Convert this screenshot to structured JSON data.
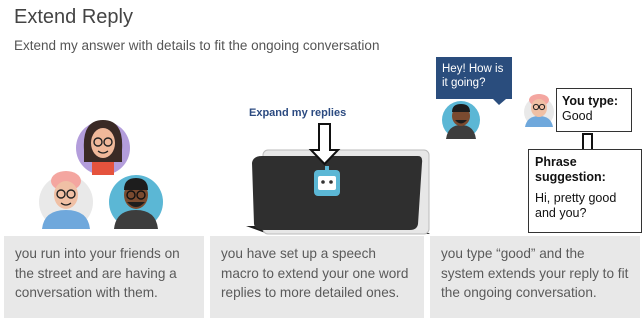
{
  "header": {
    "title": "Extend Reply",
    "subtitle": "Extend my answer with details to fit the ongoing conversation"
  },
  "scenes": [
    {
      "caption": "you run into your friends on the street and are having a conversation with them."
    },
    {
      "label": "Expand my replies",
      "caption": "you have set up a speech macro to extend your one word replies to more detailed ones."
    },
    {
      "speech_bubble": "Hey! How is it going?",
      "you_type_label": "You type:",
      "you_type_value": "Good",
      "phrase_label": "Phrase suggestion:",
      "phrase_value": "Hi, pretty good and you?",
      "caption": "you type “good” and the system extends your reply to fit the ongoing conversation."
    }
  ],
  "icons": [
    "friend-avatar-icon",
    "tablet-device-icon",
    "robot-assistant-icon",
    "down-arrow-icon"
  ],
  "colors": {
    "panel": "#e8e8e8",
    "bubble": "#2a4d7d",
    "label": "#2b4a80",
    "robot": "#5bb7d5"
  }
}
